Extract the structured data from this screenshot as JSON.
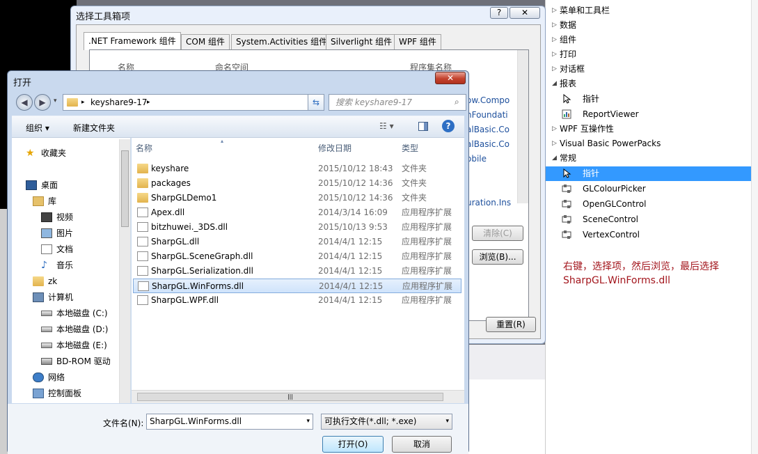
{
  "toolbox": {
    "categories": [
      {
        "label": "菜单和工具栏"
      },
      {
        "label": "数据"
      },
      {
        "label": "组件"
      },
      {
        "label": "打印"
      },
      {
        "label": "对话框"
      },
      {
        "label": "报表"
      }
    ],
    "report_items": [
      {
        "label": "指针"
      },
      {
        "label": "ReportViewer"
      }
    ],
    "categories2": [
      {
        "label": "WPF 互操作性"
      },
      {
        "label": "Visual Basic PowerPacks"
      },
      {
        "label": "常规"
      }
    ],
    "general_items": [
      {
        "label": "指针"
      },
      {
        "label": "GLColourPicker"
      },
      {
        "label": "OpenGLControl"
      },
      {
        "label": "SceneControl"
      },
      {
        "label": "VertexControl"
      }
    ],
    "note_line1": "右键，选择项，然后浏览，最后选择",
    "note_line2": "SharpGL.WinForms.dll"
  },
  "choose_dialog": {
    "title": "选择工具箱项",
    "help_btn": "?",
    "close_btn": "✕",
    "tabs": [
      ".NET Framework 组件",
      "COM 组件",
      "System.Activities 组件",
      "Silverlight 组件",
      "WPF 组件"
    ],
    "columns": [
      "名称",
      "命名空间",
      "程序集名称"
    ],
    "namespace_fragments": [
      "ow.Compo",
      "nFoundati",
      "alBasic.Co",
      "alBasic.Co",
      "obile",
      "uration.Ins"
    ],
    "clear_btn": "清除(C)",
    "browse_btn": "浏览(B)...",
    "reset_btn": "重置(R)"
  },
  "open_dialog": {
    "title": "打开",
    "close_btn": "✕",
    "address_path": "keyshare9-17",
    "search_placeholder": "搜索 keyshare9-17",
    "organize": "组织 ▾",
    "new_folder": "新建文件夹",
    "nav": {
      "favorites": "收藏夹",
      "desktop": "桌面",
      "libraries": "库",
      "videos": "视频",
      "pictures": "图片",
      "documents": "文档",
      "music": "音乐",
      "user": "zk",
      "computer": "计算机",
      "disk_c": "本地磁盘 (C:)",
      "disk_d": "本地磁盘 (D:)",
      "disk_e": "本地磁盘 (E:)",
      "bdrom": "BD-ROM 驱动",
      "network": "网络",
      "control_panel": "控制面板"
    },
    "columns": {
      "name": "名称",
      "modified": "修改日期",
      "type": "类型"
    },
    "files": [
      {
        "name": "keyshare",
        "date": "2015/10/12 18:43",
        "type": "文件夹",
        "kind": "folder"
      },
      {
        "name": "packages",
        "date": "2015/10/12 14:36",
        "type": "文件夹",
        "kind": "folder"
      },
      {
        "name": "SharpGLDemo1",
        "date": "2015/10/12 14:36",
        "type": "文件夹",
        "kind": "folder"
      },
      {
        "name": "Apex.dll",
        "date": "2014/3/14 16:09",
        "type": "应用程序扩展",
        "kind": "dll"
      },
      {
        "name": "bitzhuwei._3DS.dll",
        "date": "2015/10/13 9:53",
        "type": "应用程序扩展",
        "kind": "dll"
      },
      {
        "name": "SharpGL.dll",
        "date": "2014/4/1 12:15",
        "type": "应用程序扩展",
        "kind": "dll"
      },
      {
        "name": "SharpGL.SceneGraph.dll",
        "date": "2014/4/1 12:15",
        "type": "应用程序扩展",
        "kind": "dll"
      },
      {
        "name": "SharpGL.Serialization.dll",
        "date": "2014/4/1 12:15",
        "type": "应用程序扩展",
        "kind": "dll"
      },
      {
        "name": "SharpGL.WinForms.dll",
        "date": "2014/4/1 12:15",
        "type": "应用程序扩展",
        "kind": "dll",
        "selected": true
      },
      {
        "name": "SharpGL.WPF.dll",
        "date": "2014/4/1 12:15",
        "type": "应用程序扩展",
        "kind": "dll"
      }
    ],
    "filename_label": "文件名(N):",
    "filename_value": "SharpGL.WinForms.dll",
    "filetype_value": "可执行文件(*.dll; *.exe)",
    "open_btn": "打开(O)",
    "cancel_btn": "取消"
  },
  "colors": {
    "selection": "#3399ff",
    "note": "#a3161d",
    "close_red": "#c4432f"
  }
}
